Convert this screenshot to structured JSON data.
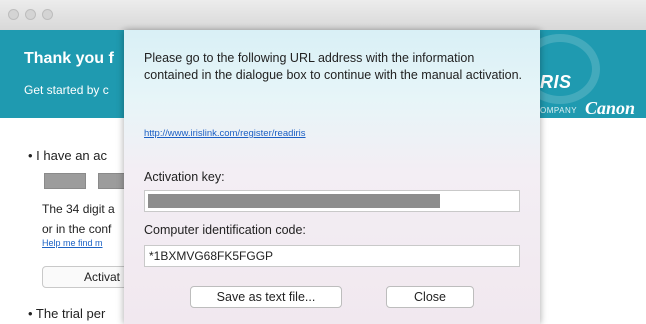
{
  "window": {
    "traffic_lights": [
      "close",
      "minimize",
      "zoom"
    ]
  },
  "background_window": {
    "banner": {
      "title": "Thank you f",
      "subtitle": "Get started by c",
      "brand_iris": "RIS",
      "brand_company": "OMPANY",
      "brand_canon": "Canon",
      "color": "#1f9ab0"
    },
    "bullet1": "• I have an ac",
    "text_line1": "The 34 digit a",
    "text_line2": "or in the conf",
    "help_link": "Help me find m",
    "activate_button": "Activat",
    "bullet2": "• The trial per"
  },
  "dialog": {
    "message": "Please go to the following URL address with the information contained in the dialogue box to continue with the manual activation.",
    "url": "http://www.irislink.com/register/readiris",
    "activation_key_label": "Activation key:",
    "activation_key_masked": true,
    "computer_id_label": "Computer identification code:",
    "computer_id_value": "*1BXMVG68FK5FGGP",
    "save_button": "Save as text file...",
    "close_button": "Close"
  }
}
